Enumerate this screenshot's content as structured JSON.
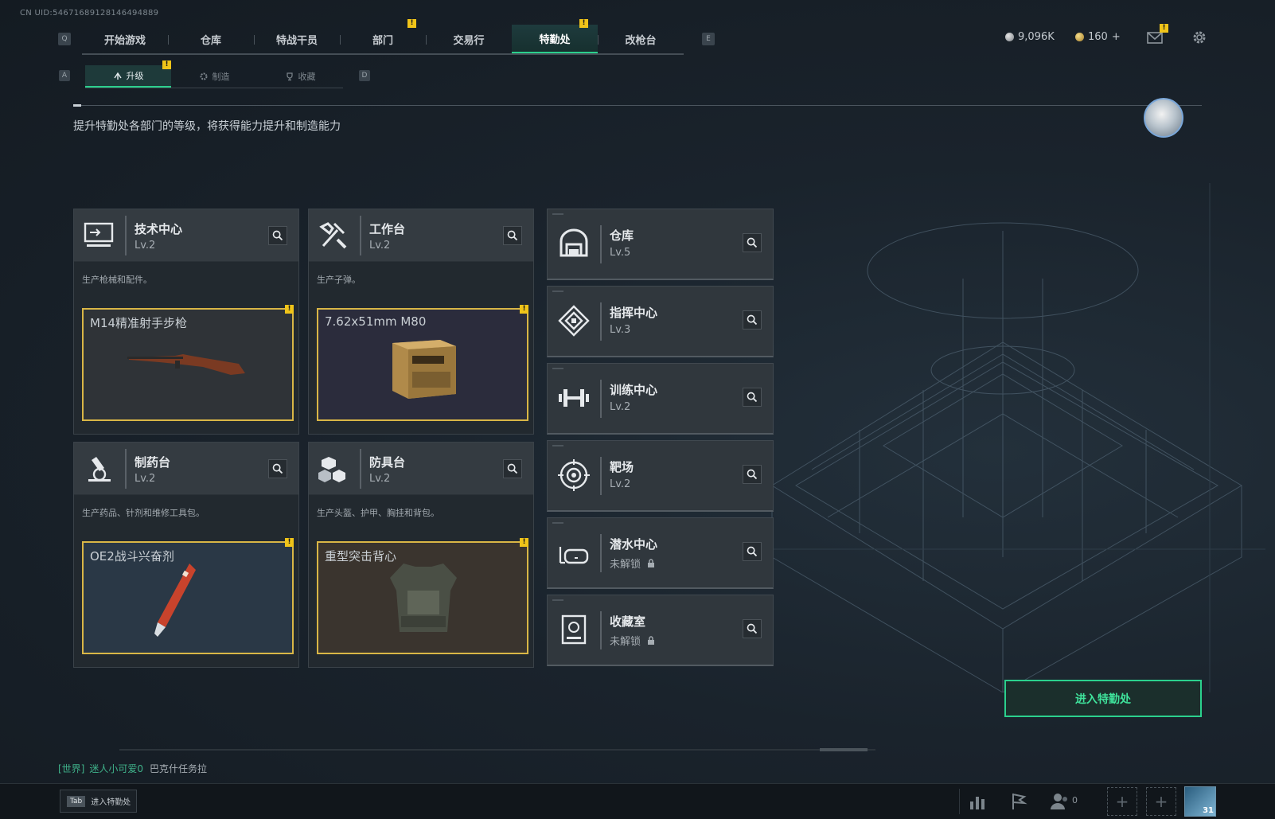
{
  "uid": "CN UID:546716891281464948​89",
  "topnav": {
    "left_key": "Q",
    "right_key": "E",
    "tabs": [
      {
        "label": "开始游戏",
        "alert": false
      },
      {
        "label": "仓库",
        "alert": false
      },
      {
        "label": "特战干员",
        "alert": false
      },
      {
        "label": "部门",
        "alert": true
      },
      {
        "label": "交易行",
        "alert": false
      },
      {
        "label": "特勤处",
        "alert": true,
        "active": true
      },
      {
        "label": "改枪台",
        "alert": false
      }
    ],
    "alert_symbol": "!"
  },
  "currency": {
    "silver": "9,096K",
    "gold": "160",
    "gold_add": "+"
  },
  "subnav": {
    "left_key": "A",
    "right_key": "D",
    "tabs": [
      {
        "label": "升级",
        "icon": "upgrade-icon",
        "active": true,
        "alert": true
      },
      {
        "label": "制造",
        "icon": "gear-icon",
        "active": false
      },
      {
        "label": "收藏",
        "icon": "trophy-icon",
        "active": false
      }
    ]
  },
  "description": "提升特勤处各部门的等级，将获得能力提升和制造能力",
  "production_cards": [
    {
      "name": "技术中心",
      "level": "Lv.2",
      "subtitle": "生产枪械和配件。",
      "craft_title": "M14精准射手步枪",
      "craft_bg": "#2f3337",
      "icon": "monitor-icon",
      "item": "rifle"
    },
    {
      "name": "工作台",
      "level": "Lv.2",
      "subtitle": "生产子弹。",
      "craft_title": "7.62x51mm M80",
      "craft_bg": "#2b2c3c",
      "icon": "tools-icon",
      "item": "ammo-box"
    },
    {
      "name": "制药台",
      "level": "Lv.2",
      "subtitle": "生产药品、针剂和维修工具包。",
      "craft_title": "OE2战斗兴奋剂",
      "craft_bg": "#2a3846",
      "icon": "microscope-icon",
      "item": "syringe"
    },
    {
      "name": "防具台",
      "level": "Lv.2",
      "subtitle": "生产头盔、护甲、胸挂和背包。",
      "craft_title": "重型突击背心",
      "craft_bg": "#3a342e",
      "icon": "cubes-icon",
      "item": "vest"
    }
  ],
  "facility_cards": [
    {
      "name": "仓库",
      "level": "Lv.5",
      "locked": false,
      "icon": "warehouse-icon"
    },
    {
      "name": "指挥中心",
      "level": "Lv.3",
      "locked": false,
      "icon": "command-icon"
    },
    {
      "name": "训练中心",
      "level": "Lv.2",
      "locked": false,
      "icon": "dumbbell-icon"
    },
    {
      "name": "靶场",
      "level": "Lv.2",
      "locked": false,
      "icon": "target-icon"
    },
    {
      "name": "潜水中心",
      "level": "未解锁",
      "locked": true,
      "icon": "diving-mask-icon"
    },
    {
      "name": "收藏室",
      "level": "未解锁",
      "locked": true,
      "icon": "collection-icon"
    }
  ],
  "enter_button": "进入特勤处",
  "chat": {
    "channel": "[世界]",
    "user": "迷人小可爱0",
    "message": "巴克什任务拉"
  },
  "bottom": {
    "tab_key": "Tab",
    "tab_label": "进入特勤处",
    "friends_count": "0",
    "slot_symbol": "+",
    "level_badge": "31"
  },
  "colors": {
    "accent": "#2bd08d",
    "alert": "#f0c419",
    "craft_border": "#d9b646"
  }
}
